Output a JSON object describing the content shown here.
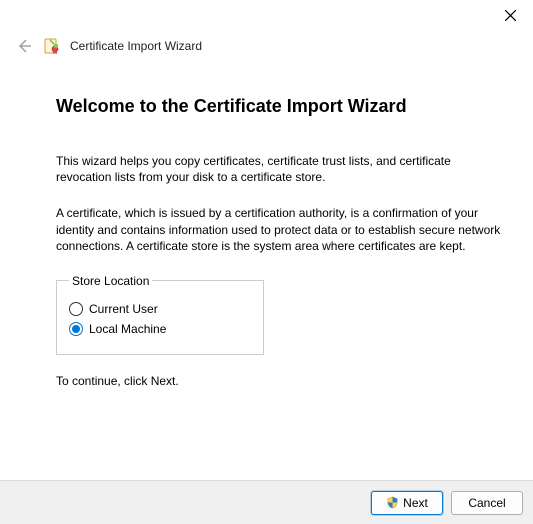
{
  "window": {
    "wizard_name": "Certificate Import Wizard"
  },
  "heading": "Welcome to the Certificate Import Wizard",
  "intro_paragraph": "This wizard helps you copy certificates, certificate trust lists, and certificate revocation lists from your disk to a certificate store.",
  "explain_paragraph": "A certificate, which is issued by a certification authority, is a confirmation of your identity and contains information used to protect data or to establish secure network connections. A certificate store is the system area where certificates are kept.",
  "store_location": {
    "legend": "Store Location",
    "options": {
      "current_user": {
        "label": "Current User",
        "selected": false
      },
      "local_machine": {
        "label": "Local Machine",
        "selected": true
      }
    }
  },
  "continue_hint": "To continue, click Next.",
  "buttons": {
    "next": "Next",
    "cancel": "Cancel"
  }
}
